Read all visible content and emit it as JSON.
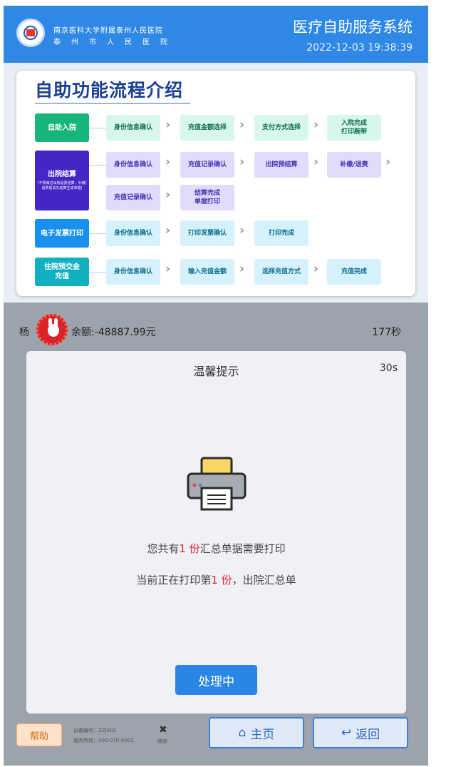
{
  "header": {
    "hospital_name": "南京医科大学附属泰州人民医院",
    "hospital_sub": "泰州市人民医院",
    "system_title": "医疗自助服务系统",
    "datetime": "2022-12-03 19:38:39"
  },
  "flow": {
    "title": "自助功能流程介绍",
    "rows": [
      {
        "category": "自助入院",
        "steps": [
          "身份信息确认",
          "充值金额选择",
          "支付方式选择",
          "入院完成\n打印腕带"
        ]
      },
      {
        "category": "出院结算",
        "category_note": "(不再做过出院退费结算，补缴/退费前请先结算生成单据)",
        "steps": [
          "身份信息确认",
          "充值记录确认",
          "出院预结算",
          "补缴/退费"
        ],
        "steps2": [
          "充值记录确认",
          "结算完成\n单据打印"
        ]
      },
      {
        "category": "电子发票打印",
        "steps": [
          "身份信息确认",
          "打印发票确认",
          "打印完成"
        ]
      },
      {
        "category": "住院预交金\n充值",
        "steps": [
          "身份信息确认",
          "输入充值金额",
          "选择充值方式",
          "充值完成"
        ]
      }
    ],
    "arrow": "›"
  },
  "patient": {
    "name_partial": "杨",
    "balance_text": "余额:-48887.99元",
    "countdown": "177秒"
  },
  "dialog": {
    "title": "温馨提示",
    "countdown": "30s",
    "msg1_pre": "您共有",
    "msg1_count": "1 份",
    "msg1_post": "汇总单据需要打印",
    "msg2_pre": "当前正在打印第",
    "msg2_count": "1 份",
    "msg2_post": "，出院汇总单",
    "button": "处理中"
  },
  "footer": {
    "help": "帮助",
    "device_no": "设备编号：ZZJ001",
    "hotline": "服务热线：400-070-0003",
    "tool_label": "维修",
    "home": "主页",
    "back": "返回"
  },
  "colors": {
    "header": "#2f88e6",
    "green_cat": "#16b67b",
    "purple_cat": "#4326c5",
    "blue_cat": "#1890f0",
    "teal_cat": "#10b0c0",
    "highlight_red": "#e22424"
  }
}
